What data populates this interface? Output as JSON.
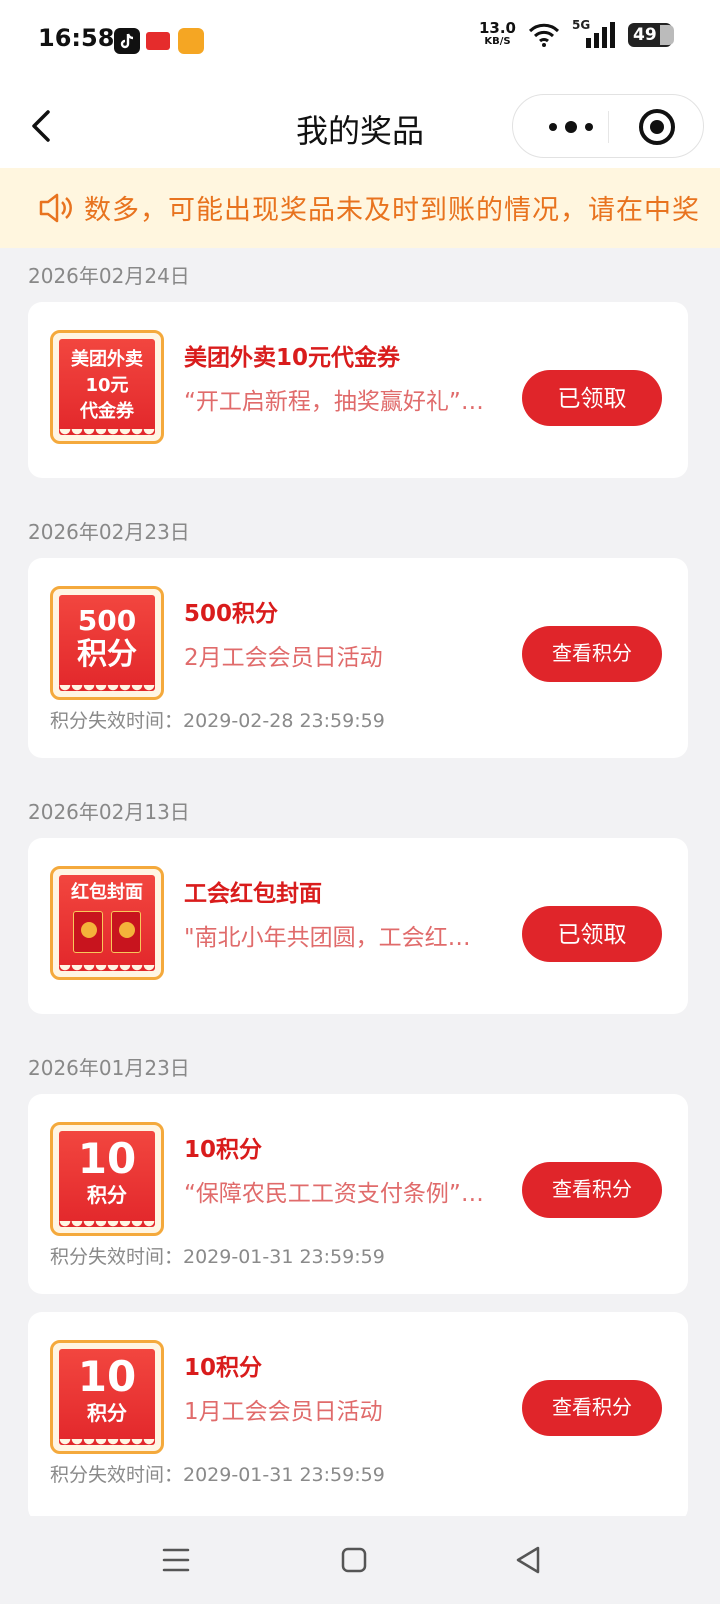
{
  "status_bar": {
    "time": "16:58",
    "apps": [
      "tiktok-icon",
      "toutiao-icon",
      "app-icon"
    ],
    "net_speed_value": "13.0",
    "net_speed_unit": "KB/S",
    "signal": "5G",
    "battery": "49"
  },
  "nav": {
    "title": "我的奖品"
  },
  "notice": {
    "text": "数多，可能出现奖品未及时到账的情况，请在中奖"
  },
  "groups": [
    {
      "date": "2026年02月24日",
      "items": [
        {
          "thumb_lines": [
            "美团外卖",
            "10元",
            "代金券"
          ],
          "title": "美团外卖10元代金券",
          "subtitle": "“开工启新程，抽奖赢好礼”活动",
          "button": "已领取"
        }
      ]
    },
    {
      "date": "2026年02月23日",
      "items": [
        {
          "thumb_lines": [
            "500",
            "积分"
          ],
          "title": "500积分",
          "subtitle": "2月工会会员日活动",
          "button": "查看积分",
          "expire": "积分失效时间：2029-02-28 23:59:59"
        }
      ]
    },
    {
      "date": "2026年02月13日",
      "items": [
        {
          "thumb_lines": [
            "红包封面"
          ],
          "title": "工会红包封面",
          "subtitle": "\"南北小年共团圆，工会红包送祝福\"",
          "button": "已领取"
        }
      ]
    },
    {
      "date": "2026年01月23日",
      "items": [
        {
          "thumb_lines": [
            "10",
            "积分"
          ],
          "title": "10积分",
          "subtitle": "“保障农民工工资支付条例”知识竞答",
          "button": "查看积分",
          "expire": "积分失效时间：2029-01-31 23:59:59"
        },
        {
          "thumb_lines": [
            "10",
            "积分"
          ],
          "title": "10积分",
          "subtitle": "1月工会会员日活动",
          "button": "查看积分",
          "expire": "积分失效时间：2029-01-31 23:59:59"
        }
      ]
    }
  ],
  "colors": {
    "accent_red": "#e0252a",
    "title_red": "#d91c1c",
    "notice_orange": "#e8731f",
    "notice_bg": "#fff6df"
  }
}
